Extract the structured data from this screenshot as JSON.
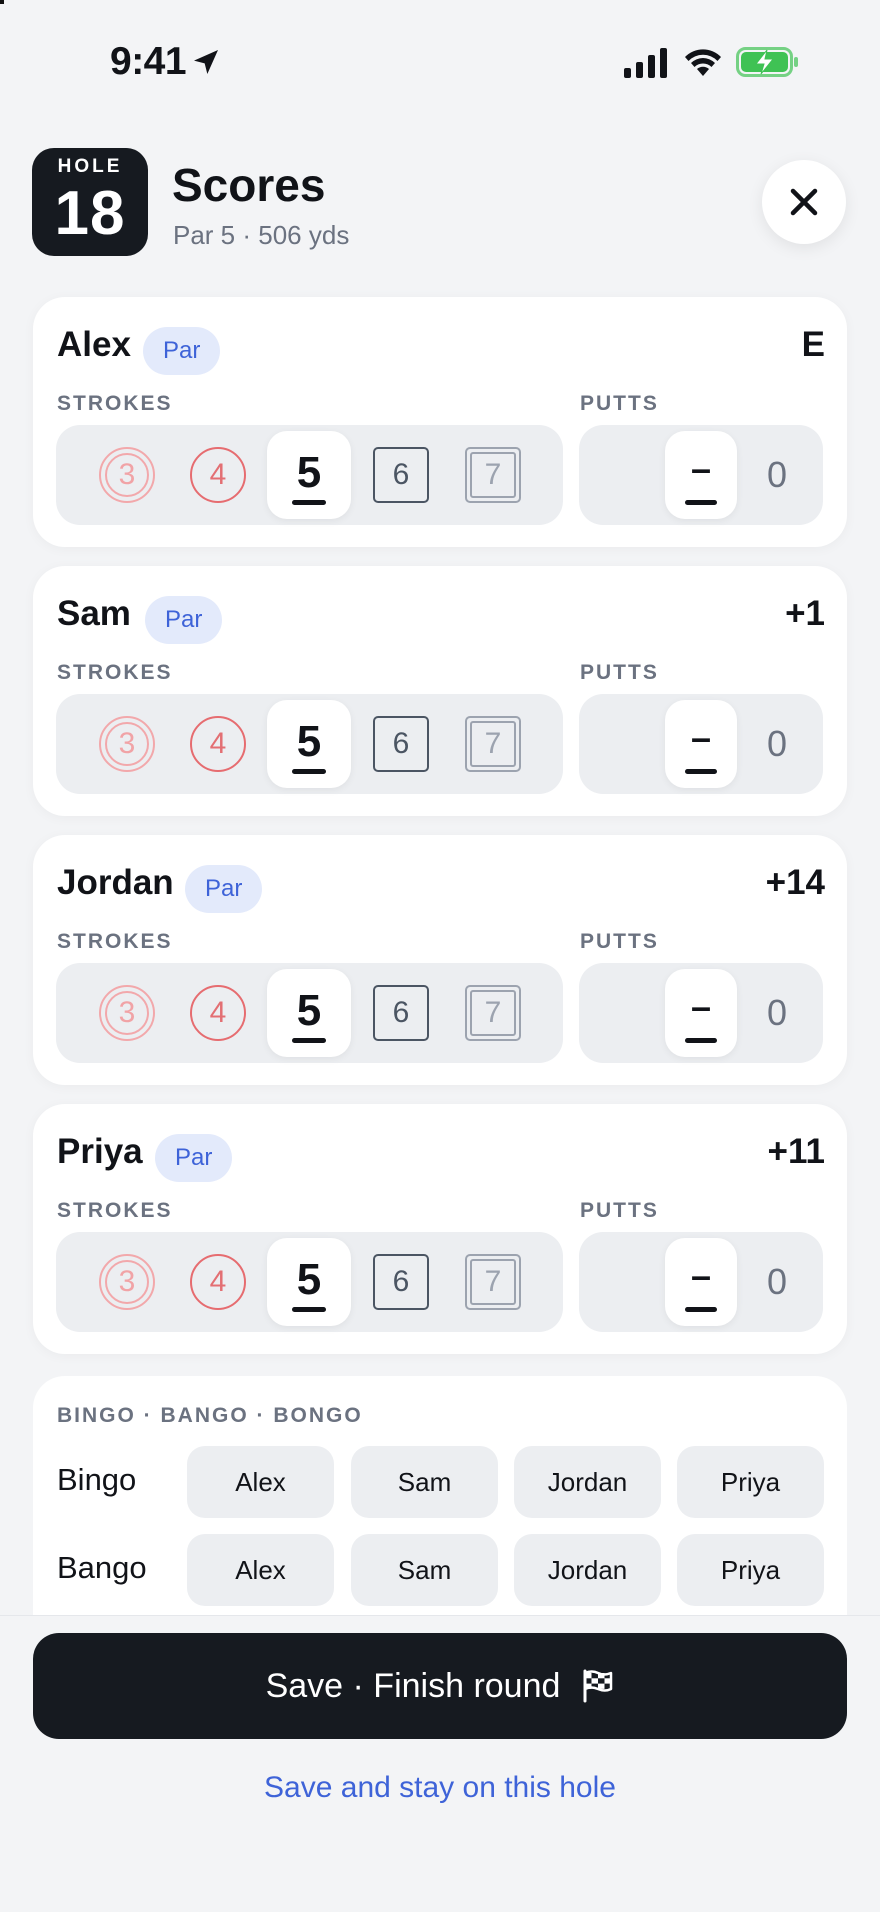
{
  "status_bar": {
    "time": "9:41"
  },
  "header": {
    "hole_label": "HOLE",
    "hole_number": "18",
    "title": "Scores",
    "subtitle": "Par 5 · 506 yds"
  },
  "labels": {
    "strokes": "STROKES",
    "putts": "PUTTS"
  },
  "players": [
    {
      "name": "Alex",
      "badge": "Par",
      "score_to_par": "E",
      "stroke_options": [
        "3",
        "4",
        "5",
        "6",
        "7"
      ],
      "selected_strokes": "5",
      "putts_selected": "–",
      "putts_next": "0"
    },
    {
      "name": "Sam",
      "badge": "Par",
      "score_to_par": "+1",
      "stroke_options": [
        "3",
        "4",
        "5",
        "6",
        "7"
      ],
      "selected_strokes": "5",
      "putts_selected": "–",
      "putts_next": "0"
    },
    {
      "name": "Jordan",
      "badge": "Par",
      "score_to_par": "+14",
      "stroke_options": [
        "3",
        "4",
        "5",
        "6",
        "7"
      ],
      "selected_strokes": "5",
      "putts_selected": "–",
      "putts_next": "0"
    },
    {
      "name": "Priya",
      "badge": "Par",
      "score_to_par": "+11",
      "stroke_options": [
        "3",
        "4",
        "5",
        "6",
        "7"
      ],
      "selected_strokes": "5",
      "putts_selected": "–",
      "putts_next": "0"
    }
  ],
  "bingo": {
    "title": "BINGO · BANGO · BONGO",
    "rows": [
      {
        "label": "Bingo",
        "players": [
          "Alex",
          "Sam",
          "Jordan",
          "Priya"
        ]
      },
      {
        "label": "Bango",
        "players": [
          "Alex",
          "Sam",
          "Jordan",
          "Priya"
        ]
      }
    ]
  },
  "footer": {
    "finish_label": "Save · Finish round",
    "stay_label": "Save and stay on this hole"
  },
  "colors": {
    "accent": "#3e63d8",
    "dark": "#161a20",
    "birdie": "#e66c70",
    "eagle": "#f2a8ab",
    "battery": "#3fc254"
  }
}
